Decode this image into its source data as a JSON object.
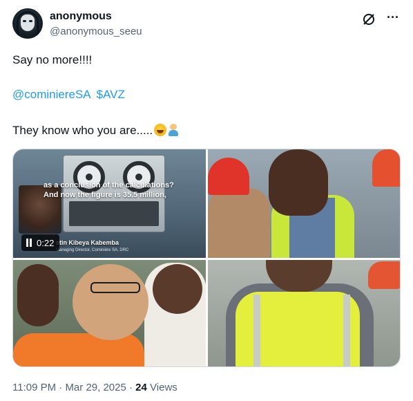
{
  "post": {
    "author_name": "anonymous",
    "author_handle": "@anonymous_seeu",
    "text_line1": "Say no more!!!!",
    "mention1": "@cominiereSA",
    "mention2": "$AVZ",
    "text_line3": "They know who you are.....",
    "icons": {
      "grok": "grok-icon",
      "more": "more-icon",
      "emoji1": "rolling-on-floor-laughing-emoji",
      "emoji2": "person-facepalming-emoji"
    },
    "colors": {
      "link": "#1d9bf0",
      "secondary_text": "#536471",
      "primary_text": "#0f1419"
    }
  },
  "media": {
    "video": {
      "caption_line1": "as a conclusion of the calculations?",
      "caption_line2": "And now the figure is 35.5 million,",
      "speaker_name": "stin Kibeya Kabemba",
      "speaker_role": "Managing Director, Cominière SA, DRC",
      "duration": "0:22"
    },
    "photos": [
      "workers-in-hard-hats",
      "man-in-glasses-orange-shirt",
      "man-in-yellow-vest"
    ]
  },
  "footer": {
    "time": "11:09 PM",
    "separator": "·",
    "date": "Mar 29, 2025",
    "views_count": "24",
    "views_label": "Views"
  }
}
